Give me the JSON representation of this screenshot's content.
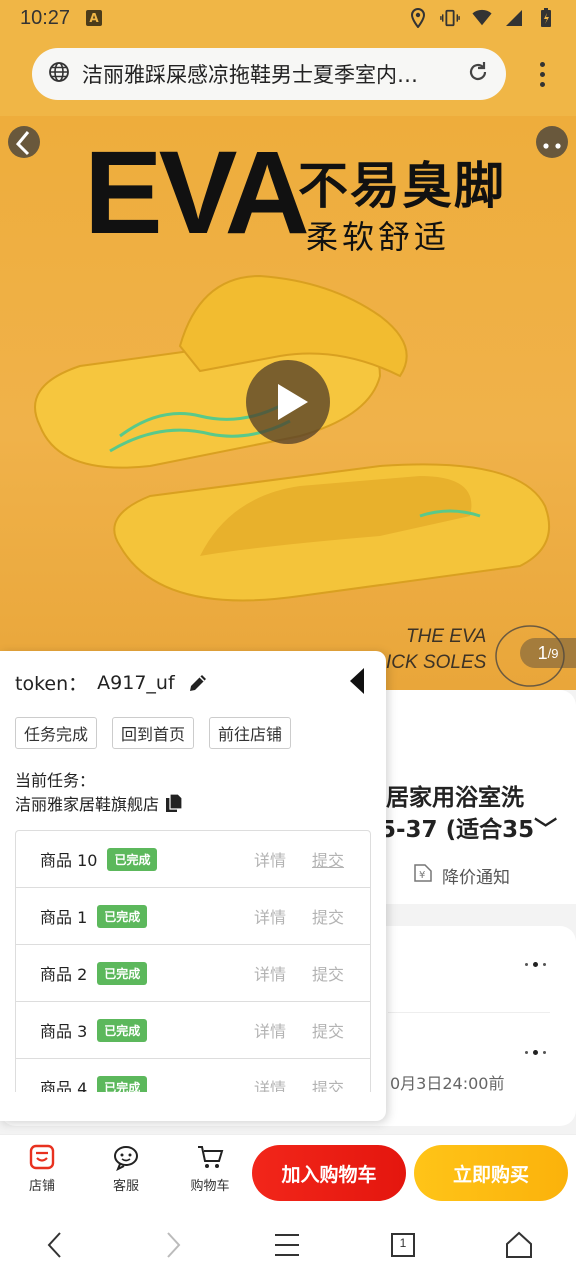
{
  "status_bar": {
    "time": "10:27",
    "notif_icon_letter": "A",
    "icons": [
      "location-icon",
      "vibrate-icon",
      "wifi-icon",
      "signal-icon",
      "battery-icon"
    ]
  },
  "browser": {
    "url_text": "洁丽雅踩屎感凉拖鞋男士夏季室内…",
    "icons": [
      "globe-icon",
      "reload-icon",
      "kebab-menu-icon"
    ]
  },
  "hero": {
    "headline": "EVA",
    "slogan_main": "不易臭脚",
    "slogan_sub": "柔软舒适",
    "sub_line1": "THE EVA",
    "sub_line2": "ICK SOLES",
    "counter_current": "1",
    "counter_total": "/9"
  },
  "product": {
    "name_line1": "居家用浴室洗",
    "name_line2": "5-37 (适合35﹀",
    "price_alert": "降价通知",
    "deadline": "0月3日24:00前"
  },
  "panel": {
    "token_label": "token：",
    "token_value": "A917_uf",
    "buttons": [
      "任务完成",
      "回到首页",
      "前往店铺"
    ],
    "current_task_label": "当前任务：",
    "shop_name": "洁丽雅家居鞋旗舰店",
    "detail_label": "详情",
    "submit_label": "提交",
    "tasks": [
      {
        "name": "商品 10",
        "status": "已完成"
      },
      {
        "name": "商品 1",
        "status": "已完成"
      },
      {
        "name": "商品 2",
        "status": "已完成"
      },
      {
        "name": "商品 3",
        "status": "已完成"
      },
      {
        "name": "商品 4",
        "status": "已完成"
      }
    ]
  },
  "action_bar": {
    "shop": "店铺",
    "service": "客服",
    "cart": "购物车",
    "add_to_cart": "加入购物车",
    "buy_now": "立即购买"
  },
  "nav": {
    "tab_count": "1"
  },
  "colors": {
    "hero_bg": "#f0b24a",
    "add_cart": "#ee2016",
    "buy_now": "#fdbb12",
    "done_badge": "#5cb85c"
  }
}
